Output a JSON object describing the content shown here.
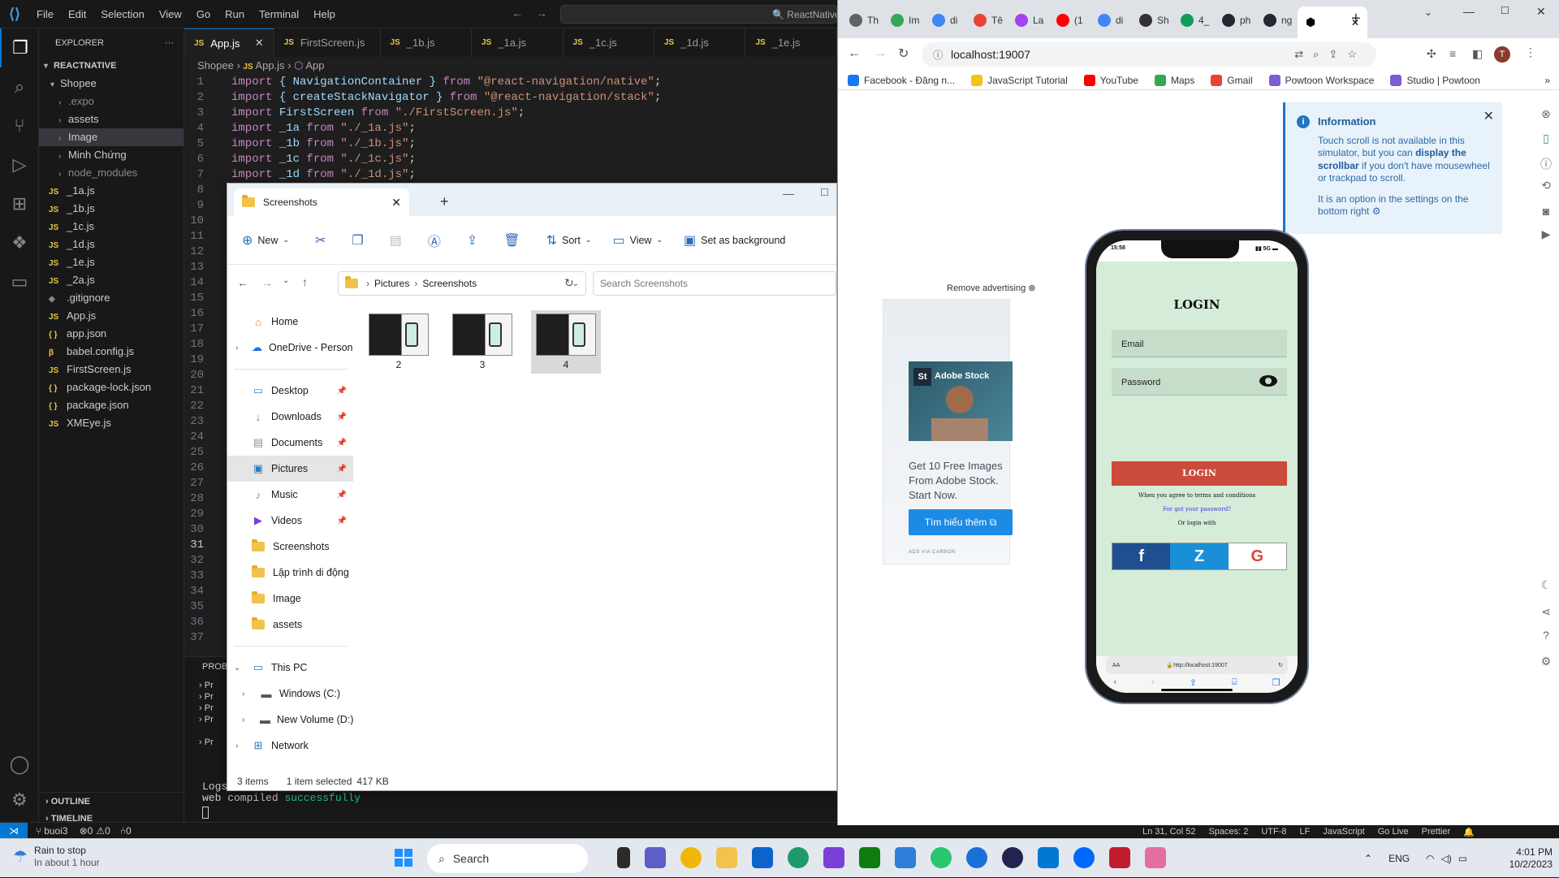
{
  "vscode": {
    "menu": [
      "File",
      "Edit",
      "Selection",
      "View",
      "Go",
      "Run",
      "Terminal",
      "Help"
    ],
    "search_text": "ReactNative",
    "explorer": {
      "header": "EXPLORER",
      "root": "REACTNATIVE",
      "folder": "Shopee",
      "items": [
        {
          "label": ".expo",
          "kind": "folder",
          "dim": true
        },
        {
          "label": "assets",
          "kind": "folder"
        },
        {
          "label": "Image",
          "kind": "folder",
          "selected": true
        },
        {
          "label": "Minh Chứng",
          "kind": "folder"
        },
        {
          "label": "node_modules",
          "kind": "folder",
          "dim": true
        },
        {
          "label": "_1a.js",
          "kind": "js"
        },
        {
          "label": "_1b.js",
          "kind": "js"
        },
        {
          "label": "_1c.js",
          "kind": "js"
        },
        {
          "label": "_1d.js",
          "kind": "js"
        },
        {
          "label": "_1e.js",
          "kind": "js"
        },
        {
          "label": "_2a.js",
          "kind": "js"
        },
        {
          "label": ".gitignore",
          "kind": "git"
        },
        {
          "label": "App.js",
          "kind": "js"
        },
        {
          "label": "app.json",
          "kind": "json"
        },
        {
          "label": "babel.config.js",
          "kind": "babel"
        },
        {
          "label": "FirstScreen.js",
          "kind": "js"
        },
        {
          "label": "package-lock.json",
          "kind": "json"
        },
        {
          "label": "package.json",
          "kind": "json"
        },
        {
          "label": "XMEye.js",
          "kind": "js"
        }
      ],
      "outline": "OUTLINE",
      "timeline": "TIMELINE"
    },
    "tabs": [
      "App.js",
      "FirstScreen.js",
      "_1b.js",
      "_1a.js",
      "_1c.js",
      "_1d.js",
      "_1e.js"
    ],
    "breadcrumb": {
      "folder": "Shopee",
      "file": "App.js",
      "symbol": "App"
    },
    "code_lines": [
      {
        "kw": "import",
        "body": "{ NavigationContainer }",
        "from": "from",
        "str": "\"@react-navigation/native\"",
        "end": ";"
      },
      {
        "kw": "import",
        "body": "{ createStackNavigator }",
        "from": "from",
        "str": "\"@react-navigation/stack\"",
        "end": ";"
      },
      {
        "kw": "import",
        "body": "FirstScreen",
        "from": "from",
        "str": "\"./FirstScreen.js\"",
        "end": ";"
      },
      {
        "kw": "import",
        "body": "_1a",
        "from": "from",
        "str": "\"./_1a.js\"",
        "end": ";"
      },
      {
        "kw": "import",
        "body": "_1b",
        "from": "from",
        "str": "\"./_1b.js\"",
        "end": ";"
      },
      {
        "kw": "import",
        "body": "_1c",
        "from": "from",
        "str": "\"./_1c.js\"",
        "end": ";"
      },
      {
        "kw": "import",
        "body": "_1d",
        "from": "from",
        "str": "\"./_1d.js\"",
        "end": ";"
      }
    ],
    "line_count": 37,
    "current_line": 31,
    "panel": {
      "tab": "PROB",
      "rows": [
        "Pr",
        "Pr",
        "Pr",
        "Pr",
        "Pr"
      ],
      "logs_label": "Logs",
      "compiled_text": "web compiled",
      "compiled_status": "successfully"
    },
    "status": {
      "branch": "buoi3",
      "errors": "0",
      "warnings": "0",
      "ports": "0",
      "position": "Ln 31, Col 52",
      "spaces": "Spaces: 2",
      "encoding": "UTF-8",
      "eol": "LF",
      "language": "JavaScript",
      "golive": "Go Live",
      "prettier": "Prettier"
    }
  },
  "file_explorer": {
    "tab_title": "Screenshots",
    "toolbar": {
      "new": "New",
      "sort": "Sort",
      "view": "View",
      "set_bg": "Set as background"
    },
    "path": [
      "Pictures",
      "Screenshots"
    ],
    "search_placeholder": "Search Screenshots",
    "nav": {
      "home": "Home",
      "onedrive": "OneDrive - Persona",
      "pinned": [
        "Desktop",
        "Downloads",
        "Documents",
        "Pictures",
        "Music",
        "Videos"
      ],
      "folders": [
        "Screenshots",
        "Lập trình di động",
        "Image",
        "assets"
      ],
      "this_pc": "This PC",
      "drives": [
        "Windows (C:)",
        "New Volume (D:)"
      ],
      "network": "Network"
    },
    "files": [
      {
        "name": "2"
      },
      {
        "name": "3"
      },
      {
        "name": "4",
        "selected": true
      }
    ],
    "status": {
      "count": "3 items",
      "selected": "1 item selected",
      "size": "417 KB"
    }
  },
  "chrome": {
    "tab_labels": [
      "Th",
      "Im",
      "di",
      "Tê",
      "La",
      "(1",
      "di",
      "Sh",
      "4_",
      "ph",
      "ng"
    ],
    "url": "localhost:19007",
    "profile_initial": "T",
    "bookmarks": [
      "Facebook - Đăng n...",
      "JavaScript Tutorial",
      "YouTube",
      "Maps",
      "Gmail",
      "Powtoon Workspace",
      "Studio | Powtoon"
    ],
    "info": {
      "title": "Information",
      "line1": "Touch scroll is not available in this simulator, but you can",
      "bold1": "display the scrollbar",
      "line2": "if you don't have mousewheel or trackpad to scroll.",
      "line3": "It is an option in the settings on the bottom right"
    },
    "ad": {
      "remove": "Remove advertising",
      "brand": "Adobe Stock",
      "brand_short": "St",
      "text": "Get 10 Free Images From Adobe Stock. Start Now.",
      "button": "Tìm hiểu thêm",
      "via": "ADS VIA CARBON"
    },
    "phone": {
      "time": "15:58",
      "network": "5G",
      "title": "LOGIN",
      "email_placeholder": "Email",
      "password_placeholder": "Password",
      "login_button": "LOGIN",
      "terms": "When you agree to terms and conditions",
      "forgot": "For got your password?",
      "or_login": "Or login with",
      "social": [
        "f",
        "Z",
        "G"
      ],
      "safari_aa": "AA",
      "safari_url": "http://localhost:19007"
    }
  },
  "taskbar": {
    "weather_title": "Rain to stop",
    "weather_sub": "In about 1 hour",
    "search": "Search",
    "lang": "ENG",
    "time": "4:01 PM",
    "date": "10/2/2023"
  }
}
